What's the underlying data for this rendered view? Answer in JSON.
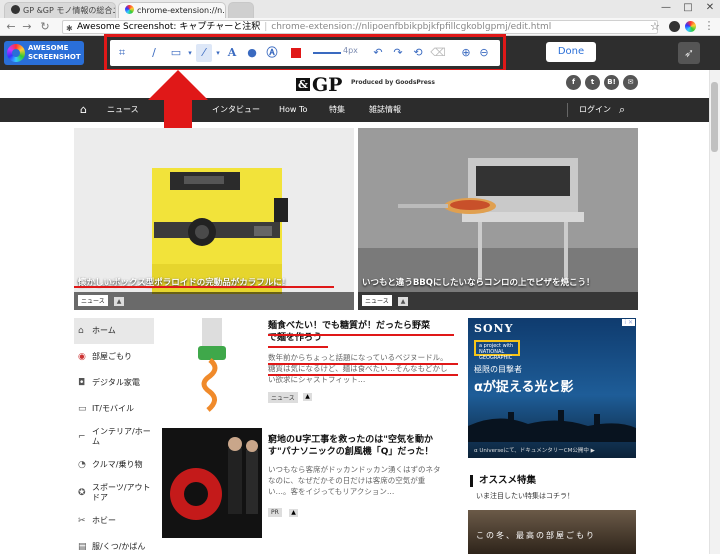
{
  "browser": {
    "tabs": [
      {
        "label": "GP &GP モノ情報の総合ニ...",
        "active": false
      },
      {
        "label": "chrome-extension://n...",
        "active": true
      }
    ],
    "window_controls": {
      "minimize": "—",
      "maximize": "□",
      "close": "✕"
    },
    "address": {
      "site_label": "Awesome Screenshot: キャプチャーと注釈",
      "url": "chrome-extension://nlipoenfbbikpbjkfpfillcgkoblgpmj/edit.html"
    }
  },
  "extension": {
    "logo_line1": "AWESOME",
    "logo_line2": "SCREENSHOT",
    "size_label": "4px",
    "done_label": "Done",
    "highlight_color": "#e01818"
  },
  "site": {
    "logo": "GP",
    "logo_amp": "&",
    "tagline": "Produced by GoodsPress",
    "social": [
      "f",
      "t",
      "B!",
      "✉"
    ],
    "nav": [
      "ニュース",
      "インタビュー",
      "How To",
      "特集",
      "雑誌情報"
    ],
    "login": "ログイン",
    "heroes": [
      {
        "caption": "懐かしいボックス型ポラロイドの完動品がカラフルに！",
        "category": "ニュース"
      },
      {
        "caption": "いつもと違うBBQにしたいならコンロの上でピザを焼こう！",
        "category": "ニュース"
      }
    ],
    "sidebar": [
      {
        "icon": "⌂",
        "label": "ホーム"
      },
      {
        "icon": "◉",
        "label": "部屋ごもり"
      },
      {
        "icon": "◘",
        "label": "デジタル家電"
      },
      {
        "icon": "▭",
        "label": "IT/モバイル"
      },
      {
        "icon": "⌐",
        "label": "インテリア/ホーム"
      },
      {
        "icon": "◔",
        "label": "クルマ/乗り物"
      },
      {
        "icon": "✪",
        "label": "スポーツ/アウトドア"
      },
      {
        "icon": "✂",
        "label": "ホビー"
      },
      {
        "icon": "▤",
        "label": "服/くつ/かばん"
      }
    ],
    "articles": [
      {
        "title_line1": "麺食べたい！でも糖質が！だったら野菜",
        "title_line2": "で麺を作ろう",
        "excerpt_line1": "数年前からちょっと話題になっているベジヌードル。",
        "excerpt_line2": "糖質は気になるけど、麺は食べたい…そんなもどかし",
        "excerpt_line3": "い欲求にシャストフィット…",
        "category": "ニュース"
      },
      {
        "title_line1": "窮地のU字工事を救ったのは\"空気を動か",
        "title_line2": "す\"パナソニックの創風機「Q」だった！",
        "excerpt_line1": "いつもなら客席がドッカンドッカン湧くはずのネタ",
        "excerpt_line2": "なのに、なぜだかその日だけは客席の空気が重",
        "excerpt_line3": "い…。客をイジってもリアクション…",
        "category": "PR"
      }
    ],
    "ad": {
      "brand": "SONY",
      "ng_line1": "a project with",
      "ng_line2": "NATIONAL",
      "ng_line3": "GEOGRAPHIC",
      "headline": "極限の目撃者",
      "big": "αが捉える光と影",
      "footer": "α Universeにて、ドキュメンタリーCM公開中 ▶",
      "tag": "i ✕"
    },
    "recommend": {
      "heading": "オススメ特集",
      "sub": "いま注目したい特集はコチラ！",
      "image_text": "この冬、最高の部屋ごもり"
    }
  }
}
